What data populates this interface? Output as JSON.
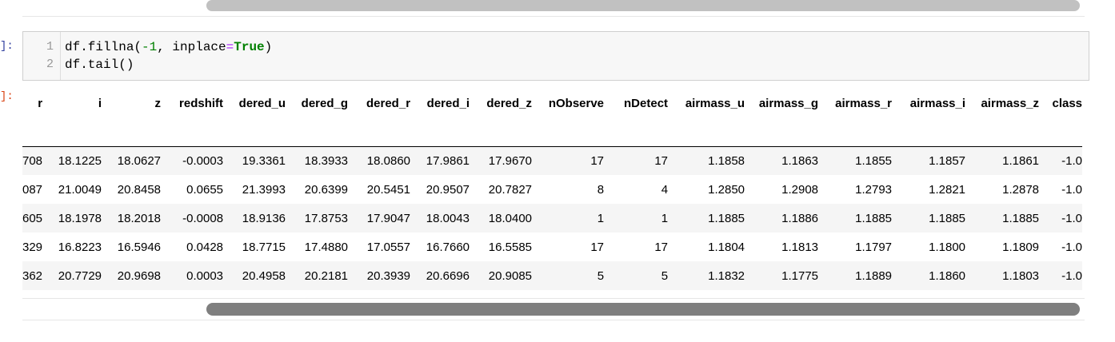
{
  "prompts": {
    "input": "]:",
    "output": "]:"
  },
  "code": {
    "line_numbers": [
      "1",
      "2"
    ],
    "line1": {
      "t1": "df.fillna(",
      "t2": "-1",
      "t3": ", inplace",
      "t4": "=",
      "t5": "True",
      "t6": ")"
    },
    "line2": "df.tail()"
  },
  "table": {
    "headers": [
      "r",
      "i",
      "z",
      "redshift",
      "dered_u",
      "dered_g",
      "dered_r",
      "dered_i",
      "dered_z",
      "nObserve",
      "nDetect",
      "airmass_u",
      "airmass_g",
      "airmass_r",
      "airmass_i",
      "airmass_z",
      "class"
    ],
    "rows": [
      [
        "708",
        "18.1225",
        "18.0627",
        "-0.0003",
        "19.3361",
        "18.3933",
        "18.0860",
        "17.9861",
        "17.9670",
        "17",
        "17",
        "1.1858",
        "1.1863",
        "1.1855",
        "1.1857",
        "1.1861",
        "-1.0"
      ],
      [
        "087",
        "21.0049",
        "20.8458",
        "0.0655",
        "21.3993",
        "20.6399",
        "20.5451",
        "20.9507",
        "20.7827",
        "8",
        "4",
        "1.2850",
        "1.2908",
        "1.2793",
        "1.2821",
        "1.2878",
        "-1.0"
      ],
      [
        "605",
        "18.1978",
        "18.2018",
        "-0.0008",
        "18.9136",
        "17.8753",
        "17.9047",
        "18.0043",
        "18.0400",
        "1",
        "1",
        "1.1885",
        "1.1886",
        "1.1885",
        "1.1885",
        "1.1885",
        "-1.0"
      ],
      [
        "329",
        "16.8223",
        "16.5946",
        "0.0428",
        "18.7715",
        "17.4880",
        "17.0557",
        "16.7660",
        "16.5585",
        "17",
        "17",
        "1.1804",
        "1.1813",
        "1.1797",
        "1.1800",
        "1.1809",
        "-1.0"
      ],
      [
        "362",
        "20.7729",
        "20.9698",
        "0.0003",
        "20.4958",
        "20.2181",
        "20.3939",
        "20.6696",
        "20.9085",
        "5",
        "5",
        "1.1832",
        "1.1775",
        "1.1889",
        "1.1860",
        "1.1803",
        "-1.0"
      ]
    ]
  }
}
